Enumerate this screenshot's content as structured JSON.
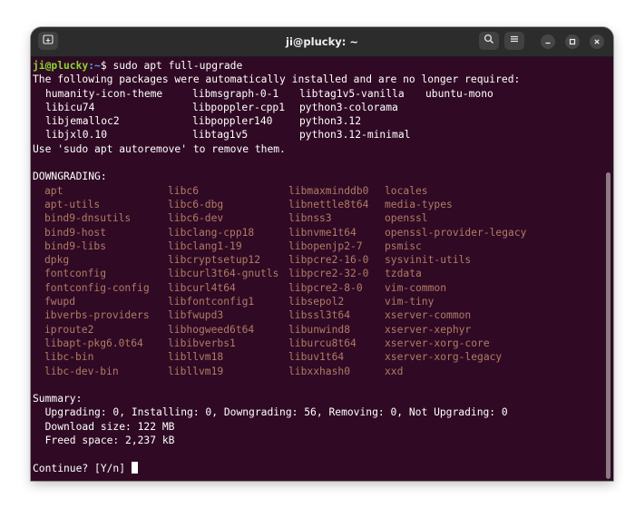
{
  "window": {
    "title": "ji@plucky: ~"
  },
  "colors": {
    "terminal_bg": "#300a24",
    "prompt_user": "#87d62b",
    "prompt_path": "#5b9bd8",
    "downgrade_text": "#b07b66",
    "text": "#ffffff"
  },
  "icons": {
    "new_tab": "new-tab-icon",
    "search": "search-icon",
    "menu": "hamburger-menu-icon",
    "minimize": "minimize-icon",
    "maximize": "maximize-icon",
    "close": "close-icon"
  },
  "terminal": {
    "prompt": {
      "user_host": "ji@plucky",
      "path": ":~",
      "symbol": "$",
      "command": " sudo apt full-upgrade"
    },
    "autoremove_intro": "The following packages were automatically installed and are no longer required:",
    "autoremove_packages": [
      [
        "humanity-icon-theme",
        "libmsgraph-0-1",
        "libtag1v5-vanilla",
        "ubuntu-mono"
      ],
      [
        "libicu74",
        "libpoppler-cpp1",
        "python3-colorama",
        ""
      ],
      [
        "libjemalloc2",
        "libpoppler140",
        "python3.12",
        ""
      ],
      [
        "libjxl0.10",
        "libtag1v5",
        "python3.12-minimal",
        ""
      ]
    ],
    "autoremove_hint": "Use 'sudo apt autoremove' to remove them.",
    "downgrading_header": "DOWNGRADING:",
    "downgrading_packages": [
      [
        "apt",
        "libc6",
        "libmaxminddb0",
        "locales"
      ],
      [
        "apt-utils",
        "libc6-dbg",
        "libnettle8t64",
        "media-types"
      ],
      [
        "bind9-dnsutils",
        "libc6-dev",
        "libnss3",
        "openssl"
      ],
      [
        "bind9-host",
        "libclang-cpp18",
        "libnvme1t64",
        "openssl-provider-legacy"
      ],
      [
        "bind9-libs",
        "libclang1-19",
        "libopenjp2-7",
        "psmisc"
      ],
      [
        "dpkg",
        "libcryptsetup12",
        "libpcre2-16-0",
        "sysvinit-utils"
      ],
      [
        "fontconfig",
        "libcurl3t64-gnutls",
        "libpcre2-32-0",
        "tzdata"
      ],
      [
        "fontconfig-config",
        "libcurl4t64",
        "libpcre2-8-0",
        "vim-common"
      ],
      [
        "fwupd",
        "libfontconfig1",
        "libsepol2",
        "vim-tiny"
      ],
      [
        "ibverbs-providers",
        "libfwupd3",
        "libssl3t64",
        "xserver-common"
      ],
      [
        "iproute2",
        "libhogweed6t64",
        "libunwind8",
        "xserver-xephyr"
      ],
      [
        "libapt-pkg6.0t64",
        "libibverbs1",
        "liburcu8t64",
        "xserver-xorg-core"
      ],
      [
        "libc-bin",
        "libllvm18",
        "libuv1t64",
        "xserver-xorg-legacy"
      ],
      [
        "libc-dev-bin",
        "libllvm19",
        "libxxhash0",
        "xxd"
      ]
    ],
    "summary_header": "Summary:",
    "summary_counts": "  Upgrading: 0, Installing: 0, Downgrading: 56, Removing: 0, Not Upgrading: 0",
    "download_size": "  Download size: 122 MB",
    "freed_space": "  Freed space: 2,237 kB",
    "continue_prompt": "Continue? [Y/n] "
  }
}
